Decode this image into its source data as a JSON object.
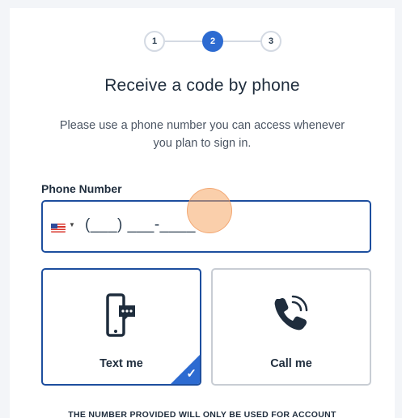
{
  "stepper": {
    "steps": [
      {
        "label": "1",
        "state": "complete"
      },
      {
        "label": "2",
        "state": "active"
      },
      {
        "label": "3",
        "state": "upcoming"
      }
    ]
  },
  "heading": "Receive a code by phone",
  "subtitle": "Please use a phone number you can access whenever you plan to sign in.",
  "phone": {
    "label": "Phone Number",
    "country_flag": "us-flag-icon",
    "value": "(___) ___-____"
  },
  "options": [
    {
      "label": "Text me",
      "icon": "smartphone-message-icon",
      "selected": true
    },
    {
      "label": "Call me",
      "icon": "phone-ringing-icon",
      "selected": false
    }
  ],
  "footer_note": "THE NUMBER PROVIDED WILL ONLY BE USED FOR ACCOUNT",
  "colors": {
    "accent": "#2d6bd1",
    "selected_border": "#1d4e9e",
    "cursor_highlight": "#f6a866"
  }
}
